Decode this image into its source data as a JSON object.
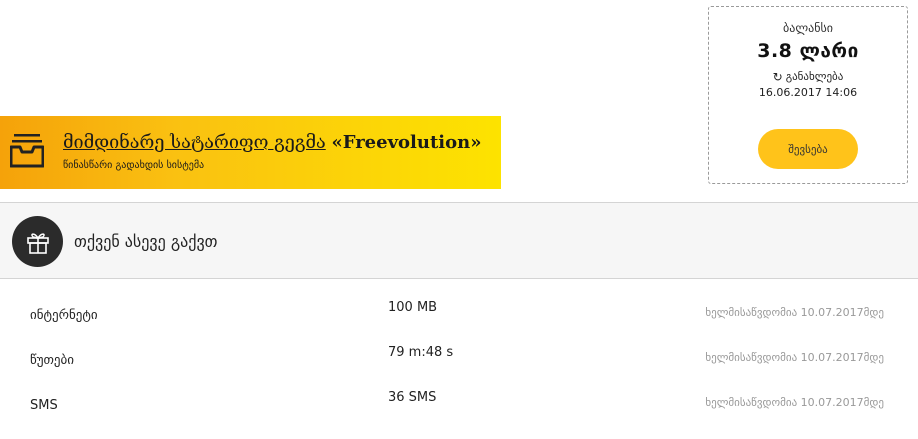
{
  "balance": {
    "title": "ბალანსი",
    "amount": "3.8 ლარი",
    "update_label": "განახლება",
    "updated_at": "16.06.2017 14:06",
    "topup_label": "შევსება"
  },
  "tariff": {
    "plan_link": "მიმდინარე სატარიფო გეგმა",
    "plan_name": "«Freevolution»",
    "subtitle": "წინასწარი გადახდის სისტემა"
  },
  "extras": {
    "title": "თქვენ ასევე გაქვთ",
    "rows": [
      {
        "label": "ინტერნეტი",
        "value": "100 MB",
        "valid_until": "ხელმისაწვდომია 10.07.2017მდე"
      },
      {
        "label": "წუთები",
        "value": "79 m:48 s",
        "valid_until": "ხელმისაწვდომია 10.07.2017მდე"
      },
      {
        "label": "SMS",
        "value": "36 SMS",
        "valid_until": "ხელმისაწვდომია 10.07.2017მდე"
      }
    ]
  },
  "icons": {
    "tariff": "inbox-tray-icon",
    "gift": "gift-icon",
    "refresh": "refresh-icon"
  },
  "colors": {
    "accent_yellow": "#ffc31a",
    "banner_start": "#f5a20a",
    "banner_end": "#fde300",
    "gift_bg": "#2b2b2b",
    "muted_text": "#999999"
  }
}
